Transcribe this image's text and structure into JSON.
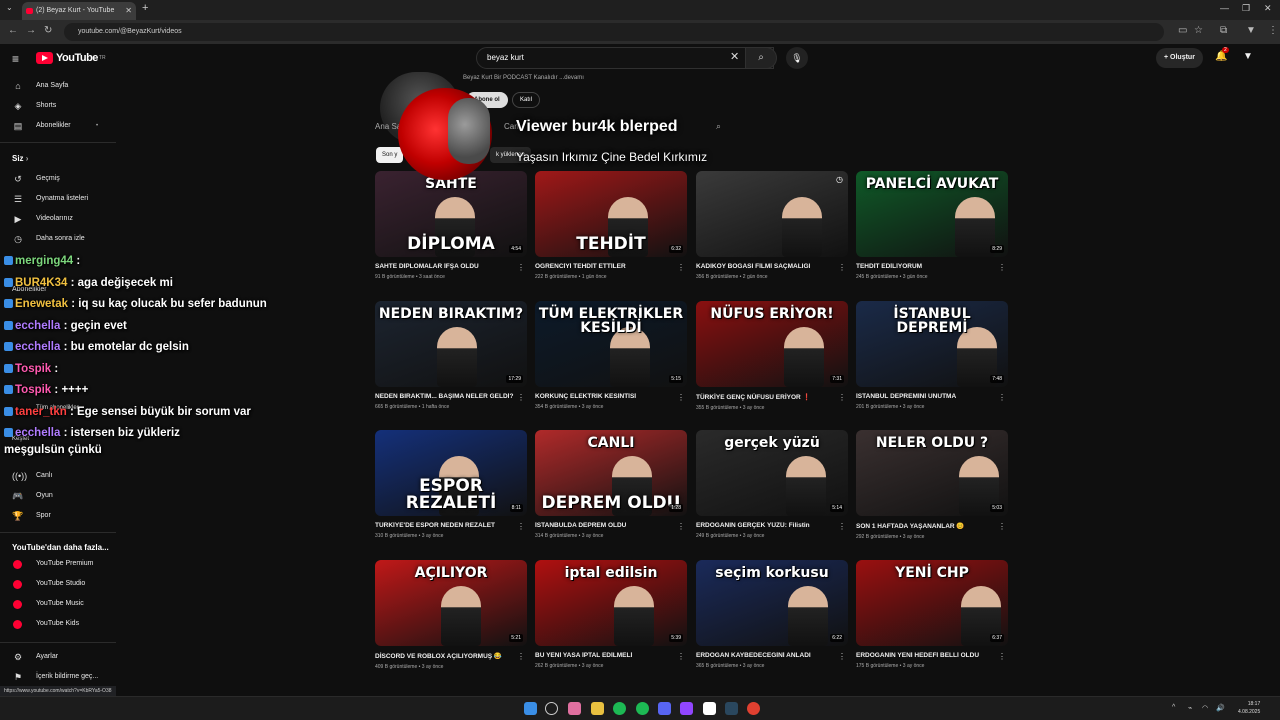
{
  "browser": {
    "tab_title": "(2) Beyaz Kurt - YouTube",
    "url": "youtube.com/@BeyazKurt/videos",
    "status_url": "https://www.youtube.com/watch?v=KbRYa5-O38"
  },
  "yt": {
    "logo": "YouTube",
    "logo_country": "TR",
    "search_value": "beyaz kurt",
    "create_label": "Oluştur",
    "bell_count": "2"
  },
  "sidebar": {
    "items_top": [
      {
        "label": "Ana Sayfa",
        "icon": "home-icon"
      },
      {
        "label": "Shorts",
        "icon": "shorts-icon"
      },
      {
        "label": "Abonelikler",
        "icon": "subscriptions-icon"
      }
    ],
    "you_header": "Siz",
    "you_items": [
      {
        "label": "Geçmiş",
        "icon": "history-icon"
      },
      {
        "label": "Oynatma listeleri",
        "icon": "playlists-icon"
      },
      {
        "label": "Videolarınız",
        "icon": "your-videos-icon"
      },
      {
        "label": "Daha sonra izle",
        "icon": "watch-later-icon"
      }
    ],
    "subs_header": "Abonelikler",
    "all_subs": "Tüm abonelikler",
    "explore_header": "Keşfet",
    "explore_items": [
      {
        "label": "Canlı",
        "icon": "live-icon"
      },
      {
        "label": "Oyun",
        "icon": "gaming-icon"
      },
      {
        "label": "Spor",
        "icon": "trophy-icon"
      }
    ],
    "more_header": "YouTube'dan daha fazla...",
    "more_items": [
      {
        "label": "YouTube Premium"
      },
      {
        "label": "YouTube Studio"
      },
      {
        "label": "YouTube Music"
      },
      {
        "label": "YouTube Kids"
      }
    ],
    "bottom_items": [
      {
        "label": "Ayarlar",
        "icon": "settings-icon"
      },
      {
        "label": "İçerik bildirme geç...",
        "icon": "flag-icon"
      }
    ]
  },
  "channel": {
    "description": "Beyaz Kurt Bir PODCAST Kanalıdır ...devamı",
    "subscribe": "Abone ol",
    "join": "Katıl",
    "tab_home": "Ana Sa",
    "tab_live": "Can",
    "chip_latest": "Son y",
    "chip_popular": "k yüklenen"
  },
  "overlay": {
    "viewer_text": "Viewer bur4k blerped",
    "slogan": "Yaşasın Irkımız Çine Bedel Kırkımız"
  },
  "videos": [
    {
      "title": "SAHTE DİPLOMALAR İFŞA OLDU",
      "meta": "91 B görüntüleme • 3 saat önce",
      "duration": "4:54",
      "thumb_top": "SAHTE",
      "thumb_bottom": "DİPLOMA",
      "bg": "#3a2230"
    },
    {
      "title": "ÖĞRENCİYİ TEHDİT ETTİLER",
      "meta": "222 B görüntüleme • 1 gün önce",
      "duration": "6:32",
      "thumb_top": "",
      "thumb_bottom": "TEHDİT",
      "bg": "#a01818"
    },
    {
      "title": "KADIKÖY BOĞASI FİLMİ SAÇMALIĞI",
      "meta": "356 B görüntüleme • 2 gün önce",
      "duration": "",
      "thumb_top": "",
      "thumb_bottom": "",
      "bg": "#3a3a3a"
    },
    {
      "title": "TEHDİT EDİLİYORUM",
      "meta": "245 B görüntüleme • 3 gün önce",
      "duration": "8:29",
      "thumb_top": "PANELCİ AVUKAT",
      "thumb_bottom": "",
      "bg": "#0f5a28"
    },
    {
      "title": "NEDEN BIRAKTIM... BAŞIMA NELER GELDİ?",
      "meta": "665 B görüntüleme • 1 hafta önce",
      "duration": "17:29",
      "thumb_top": "NEDEN BIRAKTIM?",
      "thumb_bottom": "",
      "bg": "#1c2430"
    },
    {
      "title": "KORKUNÇ ELEKTRİK KESİNTİSİ",
      "meta": "354 B görüntüleme • 3 ay önce",
      "duration": "5:15",
      "thumb_top": "TÜM ELEKTRİKLER KESİLDİ",
      "thumb_bottom": "",
      "bg": "#0c1a2a"
    },
    {
      "title": "TÜRKİYE GENÇ NÜFUSU ERİYOR ❗",
      "meta": "355 B görüntüleme • 3 ay önce",
      "duration": "7:31",
      "thumb_top": "NÜFUS ERİYOR!",
      "thumb_bottom": "",
      "bg": "#8a1010"
    },
    {
      "title": "İSTANBUL DEPREMİNİ UNUTMA",
      "meta": "201 B görüntüleme • 3 ay önce",
      "duration": "7:48",
      "thumb_top": "İSTANBUL DEPREMİ",
      "thumb_bottom": "",
      "bg": "#1a2a48"
    },
    {
      "title": "TÜRKİYE'DE ESPOR NEDEN REZALET",
      "meta": "310 B görüntüleme • 3 ay önce",
      "duration": "8:11",
      "thumb_top": "",
      "thumb_bottom": "ESPOR REZALETİ",
      "bg": "#14307a"
    },
    {
      "title": "İSTANBULDA DEPREM OLDU",
      "meta": "314 B görüntüleme • 3 ay önce",
      "duration": "1:28",
      "thumb_top": "CANLI",
      "thumb_bottom": "DEPREM OLDU",
      "bg": "#b02a2a"
    },
    {
      "title": "ERDOĞANIN GERÇEK YÜZÜ: Filistin",
      "meta": "249 B görüntüleme • 3 ay önce",
      "duration": "5:14",
      "thumb_top": "gerçek yüzü",
      "thumb_bottom": "",
      "bg": "#2a2a2a"
    },
    {
      "title": "SON 1 HAFTADA YAŞANANLAR 😊",
      "meta": "292 B görüntüleme • 3 ay önce",
      "duration": "5:03",
      "thumb_top": "NELER OLDU ?",
      "thumb_bottom": "",
      "bg": "#3a3030"
    },
    {
      "title": "DİSCORD VE ROBLOX AÇILIYORMUŞ 😂",
      "meta": "409 B görüntüleme • 3 ay önce",
      "duration": "5:21",
      "thumb_top": "AÇILIYOR",
      "thumb_bottom": "",
      "bg": "#c01818"
    },
    {
      "title": "BU YENİ YASA İPTAL EDİLMELİ",
      "meta": "262 B görüntüleme • 3 ay önce",
      "duration": "5:39",
      "thumb_top": "iptal edilsin",
      "thumb_bottom": "",
      "bg": "#b01010"
    },
    {
      "title": "ERDOĞAN KAYBEDECEĞİNİ ANLADI",
      "meta": "365 B görüntüleme • 3 ay önce",
      "duration": "6:22",
      "thumb_top": "seçim korkusu",
      "thumb_bottom": "",
      "bg": "#1a2a5a"
    },
    {
      "title": "ERDOĞANIN YENİ HEDEFİ BELLİ OLDU",
      "meta": "175 B görüntüleme • 3 ay önce",
      "duration": "6:37",
      "thumb_top": "YENİ CHP",
      "thumb_bottom": "",
      "bg": "#9a1010"
    }
  ],
  "chat": [
    {
      "user": "merging44",
      "text": ":",
      "color": "#7cd67c"
    },
    {
      "user": "BUR4K34",
      "text": ": aga değişecek mi",
      "color": "#f0c040"
    },
    {
      "user": "Enewetak",
      "text": ": iq su kaç olucak bu sefer badunun",
      "color": "#f0c040"
    },
    {
      "user": "ecchella",
      "text": ": geçin evet",
      "color": "#b07cff"
    },
    {
      "user": "ecchella",
      "text": ": bu emotelar dc gelsin",
      "color": "#b07cff"
    },
    {
      "user": "Tospik",
      "text": ":",
      "color": "#ff5ab0"
    },
    {
      "user": "Tospik",
      "text": ": ++++",
      "color": "#ff5ab0"
    },
    {
      "user": "taner_tkn",
      "text": ": Ege sensei büyük bir sorum var",
      "color": "#ff4040"
    },
    {
      "user": "ecchella",
      "text": ": istersen biz yükleriz",
      "color": "#b07cff"
    },
    {
      "user": "",
      "text": "meşgulsün çünkü",
      "color": "#ffffff"
    }
  ],
  "clock": {
    "time": "18:17",
    "date": "4.08.2025"
  }
}
